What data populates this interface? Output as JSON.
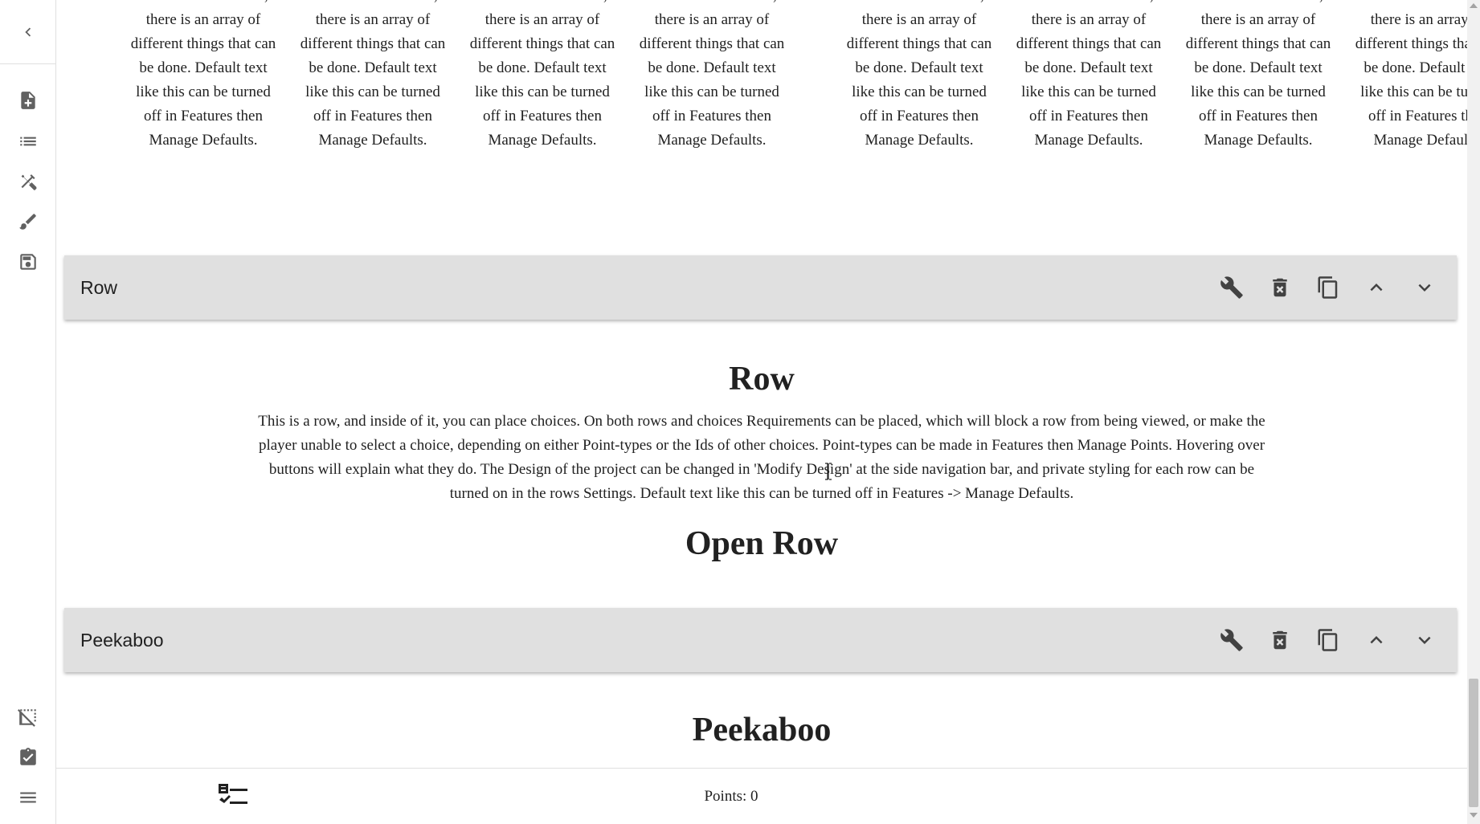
{
  "choice_columns": [
    {
      "text": "bottom of the choice, there is an array of different things that can be done. Default text like this can be turned off in Features then Manage Defaults."
    },
    {
      "text": "bottom of the choice, there is an array of different things that can be done. Default text like this can be turned off in Features then Manage Defaults."
    },
    {
      "text": "bottom of the choice, there is an array of different things that can be done. Default text like this can be turned off in Features then Manage Defaults."
    },
    {
      "text": "bottom of the choice, there is an array of different things that can be done. Default text like this can be turned off in Features then Manage Defaults."
    },
    {
      "text": "bottom of the choice, there is an array of different things that can be done. Default text like this can be turned off in Features then Manage Defaults."
    },
    {
      "text": "bottom of the choice, there is an array of different things that can be done. Default text like this can be turned off in Features then Manage Defaults."
    },
    {
      "text": "bottom of the choice, there is an array of different things that can be done. Default text like this can be turned off in Features then Manage Defaults."
    },
    {
      "text": "bottom of the choice, there is an array of different things that can be done. Default text like this can be turned off in Features then Manage Defaults."
    }
  ],
  "rows": [
    {
      "bar_label": "Row",
      "title": "Row",
      "description": "This is a row, and inside of it, you can place choices. On both rows and choices Requirements can be placed, which will block a row from being viewed, or make the player unable to select a choice, depending on either Point-types or the Ids of other choices. Point-types can be made in Features then Manage Points. Hovering over buttons will explain what they do. The Design of the project can be changed in 'Modify Design' at the side navigation bar, and private styling for each row can be turned on in the rows Settings. Default text like this can be turned off in Features -> Manage Defaults.",
      "subtitle": "Open Row"
    },
    {
      "bar_label": "Peekaboo",
      "title": "Peekaboo"
    }
  ],
  "bottom_bar": {
    "points_text": "Points: 0"
  },
  "icons": {
    "rail": [
      "chevron-left-icon",
      "file-add-icon",
      "list-icon",
      "tools-icon",
      "brush-icon",
      "save-icon",
      "select-off-icon",
      "clipboard-icon",
      "menu-icon"
    ],
    "row_tools": [
      "wrench-icon",
      "delete-icon",
      "copy-icon",
      "chevron-up-icon",
      "chevron-down-icon"
    ],
    "bottom": [
      "checklist-icon"
    ]
  },
  "colors": {
    "row_bar_bg": "#e0e0e0",
    "icon_color": "#616161",
    "text_color": "#212121"
  }
}
